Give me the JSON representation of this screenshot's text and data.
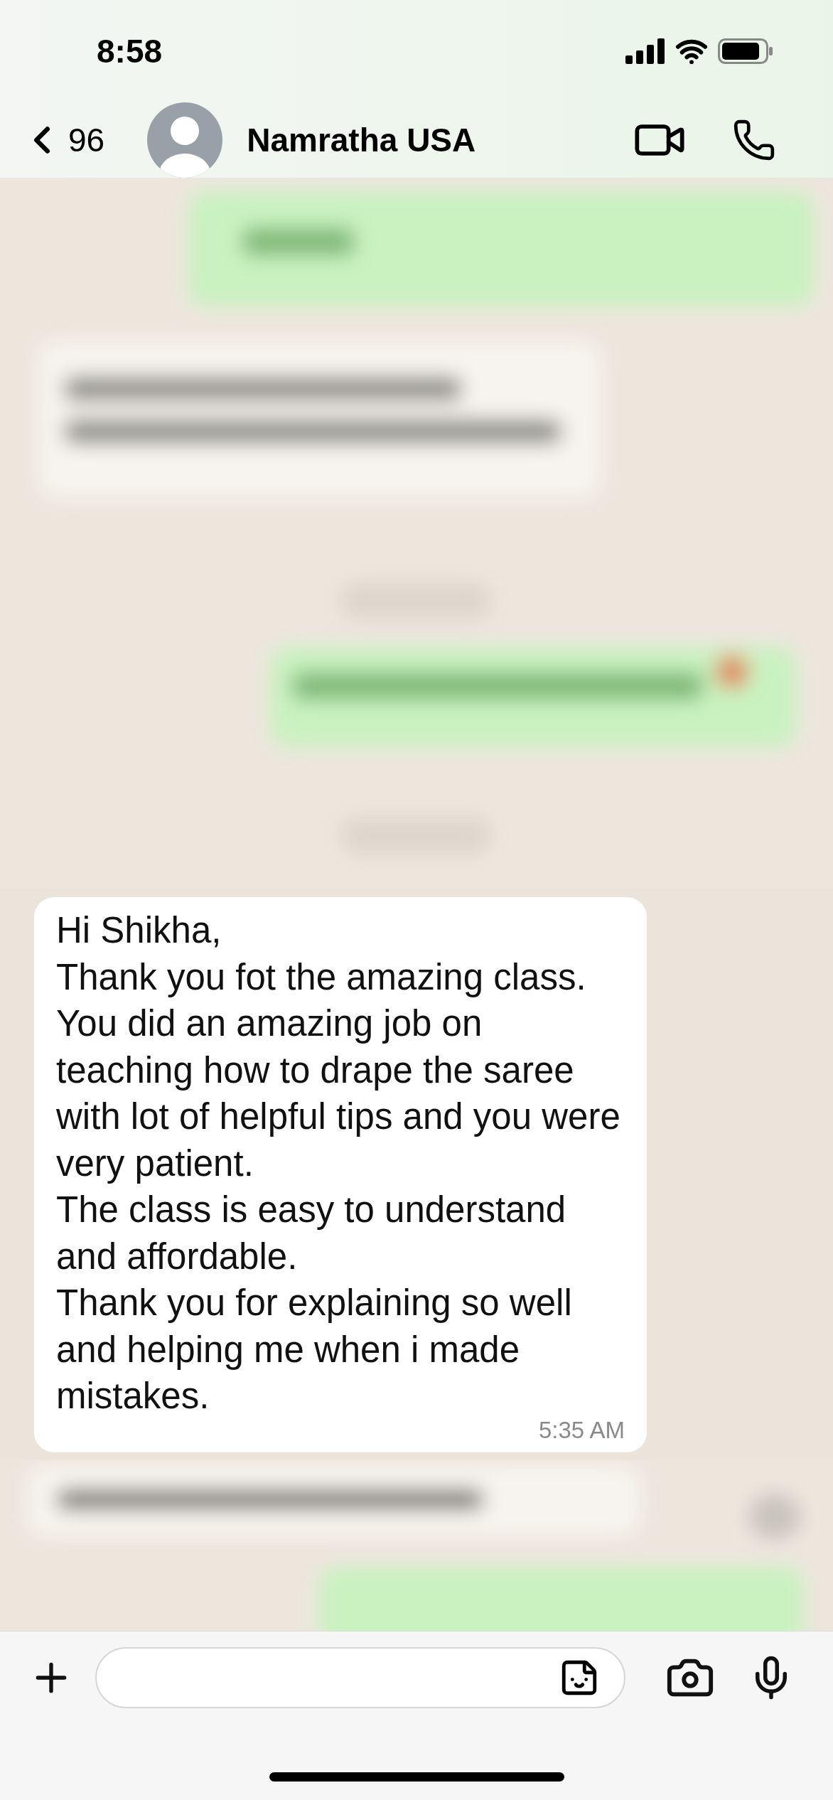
{
  "status_bar": {
    "time": "8:58"
  },
  "header": {
    "back_count": "96",
    "contact_name": "Namratha USA"
  },
  "message": {
    "text": "Hi Shikha,\nThank you fot the amazing class.\nYou did an amazing job on teaching how to drape the saree with lot of helpful tips and you were very patient.\nThe class is easy to understand and affordable.\nThank you for explaining so well and helping me when i made mistakes.",
    "time": "5:35 AM"
  }
}
